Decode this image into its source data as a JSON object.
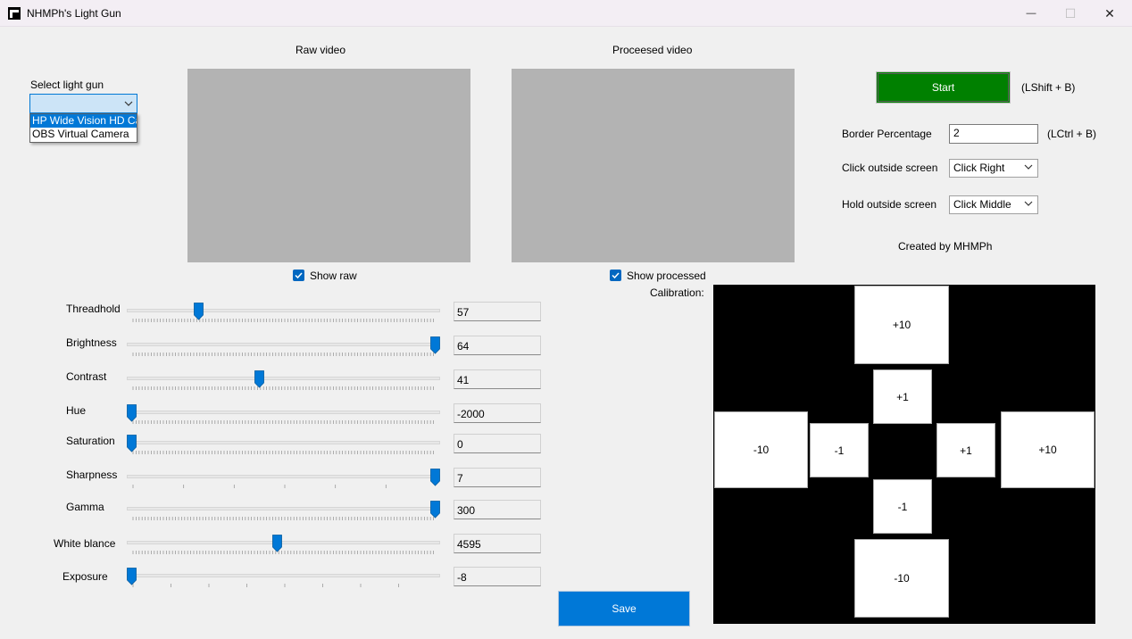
{
  "window": {
    "title": "NHMPh's Light Gun",
    "minimize_glyph": "—",
    "maximize_glyph": "☐",
    "close_glyph": "✕"
  },
  "select_light_gun": {
    "label": "Select light gun",
    "selected": "",
    "options": [
      "HP Wide Vision HD Ca",
      "OBS Virtual Camera"
    ]
  },
  "raw_video": {
    "title": "Raw video",
    "show_label": "Show raw",
    "checked": true
  },
  "processed_video": {
    "title": "Proceesed video",
    "show_label": "Show processed",
    "checked": true
  },
  "start": {
    "label": "Start",
    "shortcut": "(LShift + B)"
  },
  "border_percentage": {
    "label": "Border Percentage",
    "value": "2",
    "shortcut": "(LCtrl + B)"
  },
  "click_outside": {
    "label": "Click outside screen",
    "value": "Click Right"
  },
  "hold_outside": {
    "label": "Hold outside screen",
    "value": "Click Middle"
  },
  "credit": "Created by MHMPh",
  "calibration": {
    "label": "Calibration:",
    "top_big": "+10",
    "top_small": "+1",
    "left_big": "-10",
    "left_small": "-1",
    "right_small": "+1",
    "right_big": "+10",
    "bottom_small": "-1",
    "bottom_big": "-10"
  },
  "sliders": [
    {
      "label": "Threadhold",
      "value": "57",
      "position": 0.22,
      "ticks": "dense"
    },
    {
      "label": "Brightness",
      "value": "64",
      "position": 1.0,
      "ticks": "dense"
    },
    {
      "label": "Contrast",
      "value": "41",
      "position": 0.42,
      "ticks": "dense"
    },
    {
      "label": "Hue",
      "value": "-2000",
      "position": 0.0,
      "ticks": "dense"
    },
    {
      "label": "Saturation",
      "value": "0",
      "position": 0.0,
      "ticks": "dense"
    },
    {
      "label": "Sharpness",
      "value": "7",
      "position": 1.0,
      "ticks": "sparse7"
    },
    {
      "label": "Gamma",
      "value": "300",
      "position": 1.0,
      "ticks": "dense"
    },
    {
      "label": "White blance",
      "value": "4595",
      "position": 0.48,
      "ticks": "dense"
    },
    {
      "label": "Exposure",
      "value": "-8",
      "position": 0.0,
      "ticks": "sparse9"
    }
  ],
  "save": {
    "label": "Save"
  },
  "colors": {
    "accent": "#0078d7",
    "start_bg": "#008000",
    "video_bg": "#b3b3b3"
  }
}
